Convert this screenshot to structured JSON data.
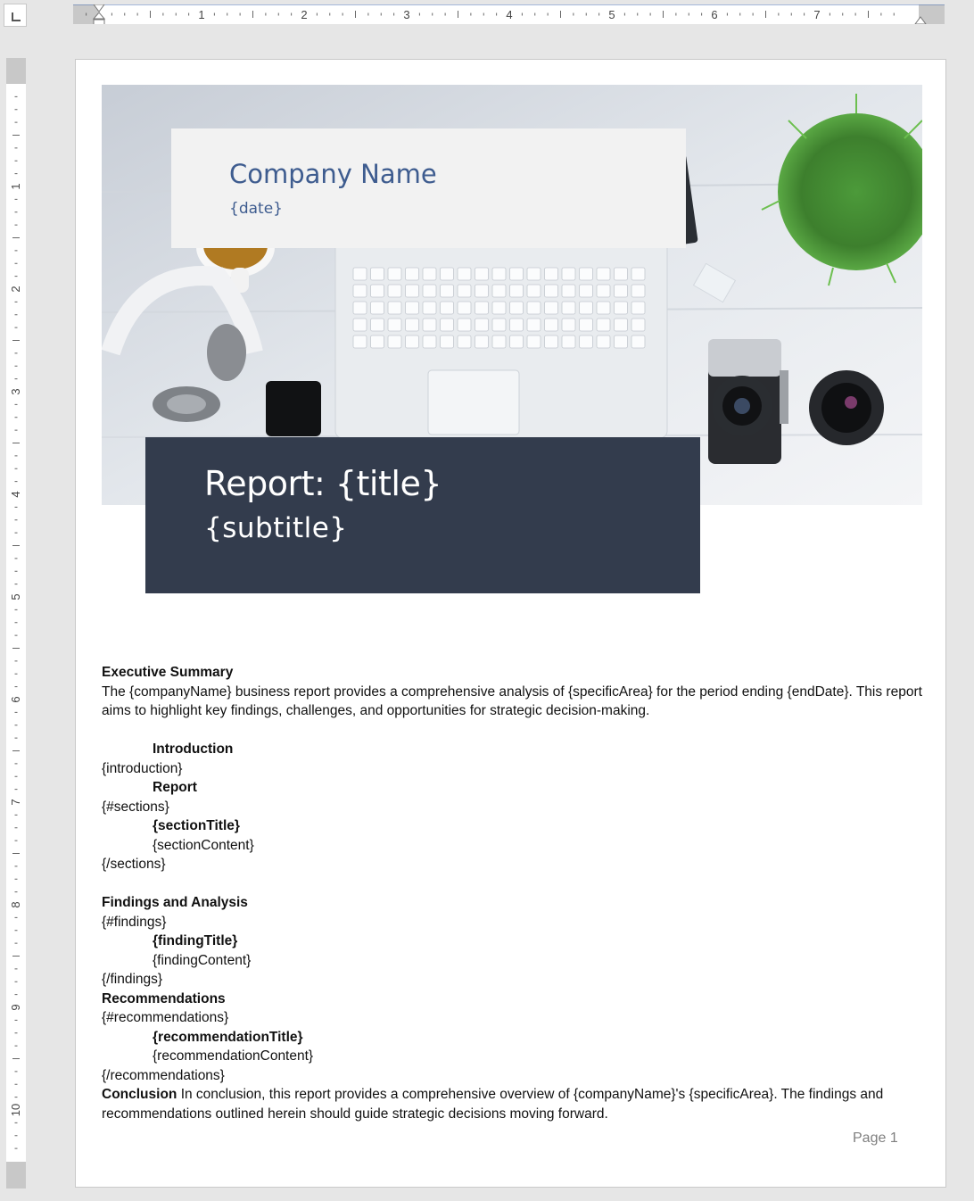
{
  "ruler": {
    "horizontal_numbers": [
      "1",
      "2",
      "3",
      "4",
      "5",
      "6",
      "7"
    ],
    "vertical_numbers": [
      "1",
      "2",
      "3",
      "4",
      "5",
      "6",
      "7",
      "8",
      "9",
      "10"
    ]
  },
  "cover": {
    "company_name": "Company Name",
    "date": "{date}",
    "title": "Report: {title}",
    "subtitle": "{subtitle}",
    "colors": {
      "accent": "#3e5c8f",
      "title_bg": "#333c4d",
      "company_bg": "#f2f2f2"
    }
  },
  "content": {
    "exec_heading": "Executive Summary",
    "exec_text": "The {companyName} business report provides a comprehensive analysis of {specificArea} for the period ending {endDate}. This report aims to highlight key findings, challenges, and opportunities for strategic decision-making.",
    "intro_heading": "Introduction",
    "intro_tag": "{introduction}",
    "report_heading": "Report",
    "sections_open": "{#sections}",
    "section_title": "{sectionTitle}",
    "section_content": "{sectionContent}",
    "sections_close": "{/sections}",
    "findings_heading": "Findings and Analysis",
    "findings_open": "{#findings}",
    "finding_title": "{findingTitle}",
    "finding_content": "{findingContent}",
    "findings_close": "{/findings}",
    "recommendations_heading": "Recommendations",
    "recommendations_open": "{#recommendations}",
    "recommendation_title": "{recommendationTitle}",
    "recommendation_content": "{recommendationContent}",
    "recommendations_close": "{/recommendations}",
    "conclusion_heading": "Conclusion",
    "conclusion_text": " In conclusion, this report provides a comprehensive overview of {companyName}'s {specificArea}. The findings and recommendations outlined herein should guide strategic decisions moving forward."
  },
  "footer": {
    "page_label": "Page 1"
  }
}
